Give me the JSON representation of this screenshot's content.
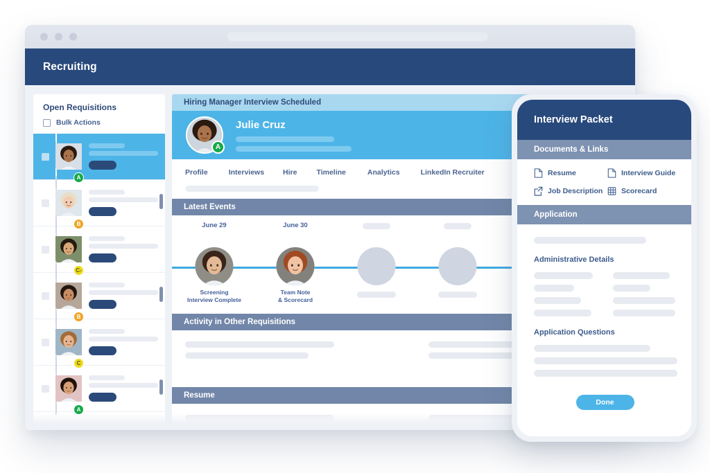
{
  "browser": {
    "url_placeholder": "",
    "dots": [
      "close-dot",
      "minimize-dot",
      "maximize-dot"
    ]
  },
  "app": {
    "title": "Recruiting"
  },
  "sidebar": {
    "title": "Open Requisitions",
    "bulk_actions_label": "Bulk Actions",
    "rows": [
      {
        "grade": "A",
        "grade_color": "#16a94a",
        "selected": true,
        "skin": "#a9734c",
        "hair": "#2b1a10",
        "bg": "#d8dfe6"
      },
      {
        "grade": "B",
        "grade_color": "#f0a526",
        "selected": false,
        "skin": "#f2cdb4",
        "hair": "#e8dfc9",
        "bg": "#dfe6ec"
      },
      {
        "grade": "C-",
        "grade_color": "#eedb1f",
        "selected": false,
        "skin": "#d9a878",
        "hair": "#241a12",
        "bg": "#7d8f6a"
      },
      {
        "grade": "B",
        "grade_color": "#f0a526",
        "selected": false,
        "skin": "#c78d62",
        "hair": "#23160f",
        "bg": "#b6a79a"
      },
      {
        "grade": "C",
        "grade_color": "#eedb1f",
        "selected": false,
        "skin": "#e6b58f",
        "hair": "#a36b3a",
        "bg": "#9fb6c6"
      },
      {
        "grade": "A",
        "grade_color": "#16a94a",
        "selected": false,
        "skin": "#d8a078",
        "hair": "#201208",
        "bg": "#e2c3c3"
      }
    ]
  },
  "main": {
    "status_header": "Hiring Manager Interview Scheduled",
    "candidate": {
      "name": "Julie Cruz",
      "grade": "A",
      "grade_color": "#16a94a"
    },
    "tabs": [
      {
        "label": "Profile"
      },
      {
        "label": "Interviews"
      },
      {
        "label": "Hire"
      },
      {
        "label": "Timeline"
      },
      {
        "label": "Analytics"
      },
      {
        "label": "LinkedIn Recruiter"
      }
    ],
    "sections": [
      {
        "label": "Latest Events"
      },
      {
        "label": "Activity in Other Requisitions"
      },
      {
        "label": "Resume"
      }
    ],
    "timeline": {
      "events": [
        {
          "date": "June 29",
          "caption_line1": "Screening",
          "caption_line2": "Interview Complete",
          "has_photo": true,
          "skin": "#e3b996",
          "hair": "#3a241a",
          "bg": "#8f8d86"
        },
        {
          "date": "June 30",
          "caption_line1": "Team Note",
          "caption_line2": "& Scorecard",
          "has_photo": true,
          "skin": "#f0c3a4",
          "hair": "#a14a22",
          "bg": "#83817c"
        },
        {
          "date": "",
          "caption_line1": "",
          "caption_line2": "",
          "has_photo": false
        },
        {
          "date": "",
          "caption_line1": "",
          "caption_line2": "",
          "has_photo": false
        },
        {
          "date": "",
          "caption_line1": "",
          "caption_line2": "",
          "has_photo": false
        }
      ]
    }
  },
  "packet": {
    "title": "Interview Packet",
    "documents_section": "Documents & Links",
    "documents": [
      {
        "label": "Resume",
        "icon": "document-icon"
      },
      {
        "label": "Interview Guide",
        "icon": "document-icon"
      },
      {
        "label": "Job Description",
        "icon": "external-link-icon"
      },
      {
        "label": "Scorecard",
        "icon": "grid-table-icon"
      }
    ],
    "application_section": "Application",
    "administrative_details_label": "Administrative Details",
    "application_questions_label": "Application Questions",
    "done_label": "Done"
  },
  "colors": {
    "navy": "#28497c",
    "slate": "#7186a8",
    "sky": "#4db4e7",
    "sky_light": "#a8d8f0",
    "page_bg": "#eef1f6",
    "placeholder": "#e7eaf0"
  }
}
